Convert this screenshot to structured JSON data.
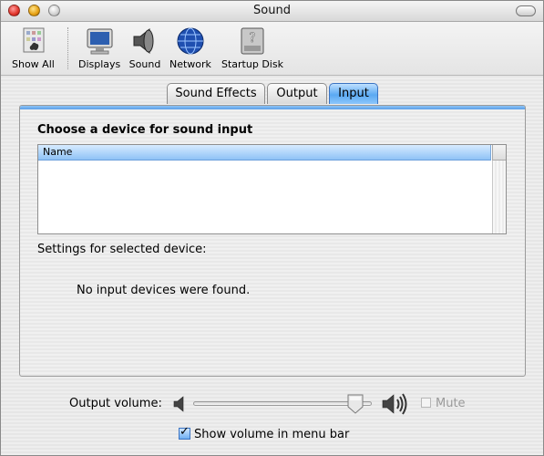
{
  "window": {
    "title": "Sound"
  },
  "toolbar": {
    "items": [
      {
        "label": "Show All",
        "icon": "show-all-icon"
      },
      {
        "label": "Displays",
        "icon": "display-icon"
      },
      {
        "label": "Sound",
        "icon": "speaker-icon"
      },
      {
        "label": "Network",
        "icon": "globe-icon"
      },
      {
        "label": "Startup Disk",
        "icon": "hard-disk-icon"
      }
    ]
  },
  "tabs": [
    {
      "label": "Sound Effects",
      "active": false
    },
    {
      "label": "Output",
      "active": false
    },
    {
      "label": "Input",
      "active": true
    }
  ],
  "panel": {
    "heading": "Choose a device for sound input",
    "list": {
      "columns": [
        "Name"
      ],
      "rows": []
    },
    "settings_label": "Settings for selected device:",
    "empty_message": "No input devices were found."
  },
  "volume": {
    "label": "Output volume:",
    "level": 0.95,
    "mute_label": "Mute",
    "mute_checked": false,
    "mute_enabled": false
  },
  "menu_bar_option": {
    "label": "Show volume in menu bar",
    "checked": true
  },
  "colors": {
    "accent": "#5aa9f2",
    "header_blue": "#8fc2f6"
  }
}
